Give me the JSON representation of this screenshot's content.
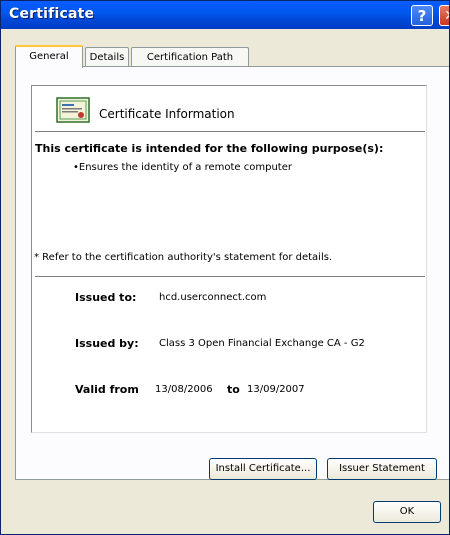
{
  "window": {
    "title": "Certificate",
    "help_glyph": "?",
    "close_glyph": "✕"
  },
  "tabs": [
    {
      "label": "General",
      "active": true
    },
    {
      "label": "Details",
      "active": false
    },
    {
      "label": "Certification Path",
      "active": false
    }
  ],
  "header": {
    "title": "Certificate Information",
    "icon": "certificate-icon"
  },
  "purpose": {
    "title": "This certificate is intended for the following purpose(s):",
    "items": [
      "•Ensures the identity of a remote computer"
    ]
  },
  "refer_text": "* Refer to the certification authority's statement for details.",
  "fields": {
    "issued_to": {
      "label": "Issued to:",
      "value": "hcd.userconnect.com"
    },
    "issued_by": {
      "label": "Issued by:",
      "value": "Class 3 Open Financial Exchange CA - G2"
    },
    "valid": {
      "from_label": "Valid from",
      "from": "13/08/2006",
      "to_label": "to",
      "to": "13/09/2007"
    }
  },
  "buttons": {
    "install": "Install Certificate...",
    "issuer": "Issuer Statement",
    "ok": "OK"
  }
}
